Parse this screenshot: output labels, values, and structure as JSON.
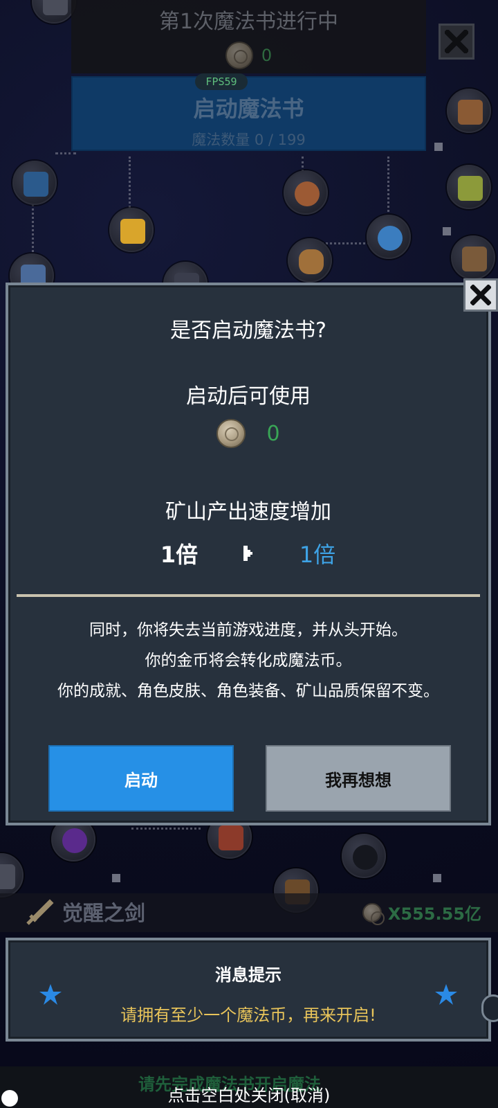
{
  "top_panel": {
    "title": "第1次魔法书进行中",
    "coin_value": "0",
    "fps": "FPS59",
    "start_banner_title": "启动魔法书",
    "magic_count": "魔法数量 0 / 199"
  },
  "dialog": {
    "title": "是否启动魔法书?",
    "subtitle": "启动后可使用",
    "coin_value": "0",
    "mine_label": "矿山产出速度增加",
    "multiplier_from": "1倍",
    "multiplier_to": "1倍",
    "note_lines": [
      "同时，你将失去当前游戏进度，并从头开始。",
      "你的金币将会转化成魔法币。",
      "你的成就、角色皮肤、角色装备、矿山品质保留不变。"
    ],
    "start_button": "启动",
    "cancel_button": "我再想想"
  },
  "bottom": {
    "sword_label": "觉醒之剑",
    "sword_value": "X555.55亿",
    "message_title": "消息提示",
    "message_text": "请拥有至少一个魔法币，再来开启!",
    "partial_hidden_text": "请先完成魔法书开启魔法",
    "close_hint": "点击空白处关闭(取消)"
  },
  "colors": {
    "dialog_bg": "#27313d",
    "dialog_border": "#7a8794",
    "start_button": "#2690e6",
    "cancel_button": "#9aa4ae",
    "coin_value_green": "#39a556",
    "multiplier_blue": "#3ea3e6",
    "message_yellow": "#e8c45a",
    "star_blue": "#2a8ae6"
  },
  "icons": [
    "coin-icon",
    "close-icon",
    "arrow-right-icon",
    "star-icon",
    "sword-icon"
  ]
}
